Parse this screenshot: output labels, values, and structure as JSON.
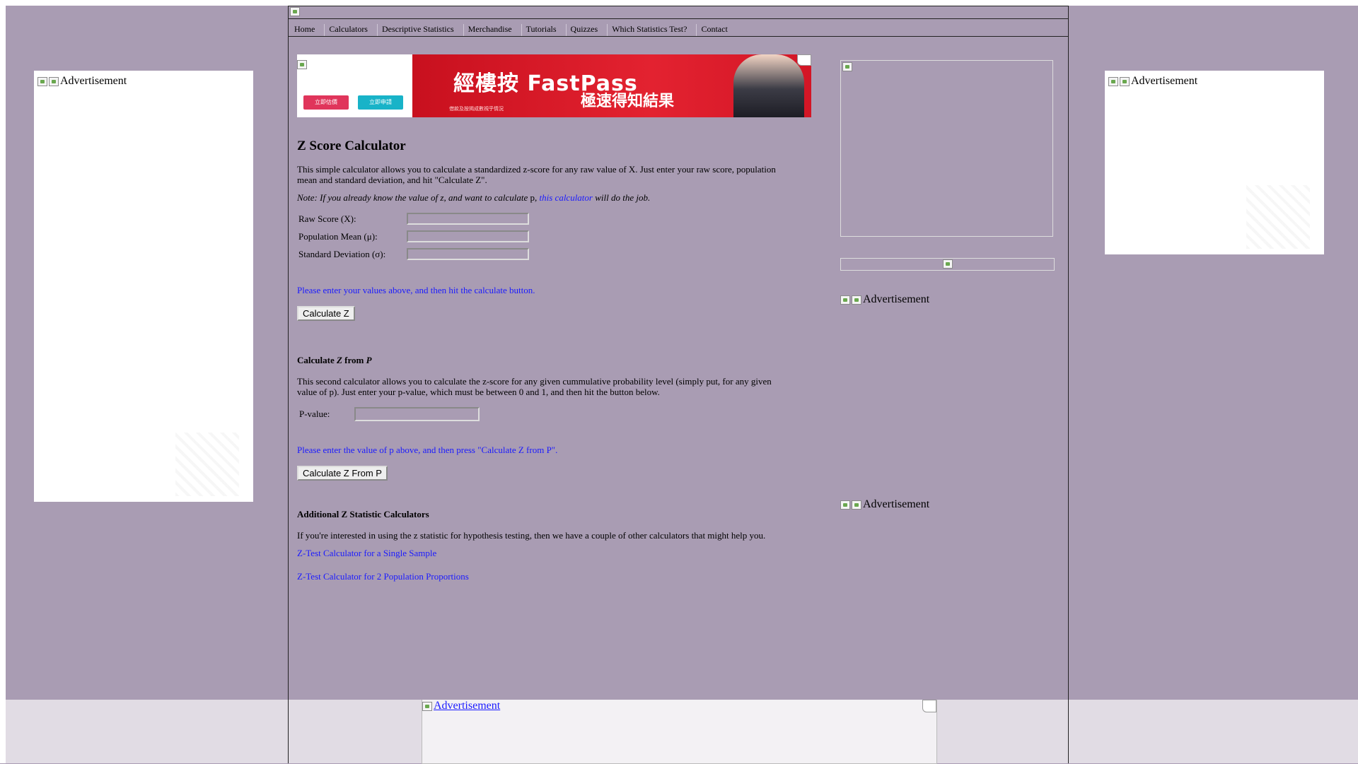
{
  "page": {
    "background": "#a99cb3",
    "link_color": "#1a1aff"
  },
  "nav": {
    "items": [
      "Home",
      "Calculators",
      "Descriptive Statistics",
      "Merchandise",
      "Tutorials",
      "Quizzes",
      "Which Statistics Test?",
      "Contact"
    ]
  },
  "ads": {
    "left_label": "Advertisement",
    "right_label": "Advertisement",
    "sidebar_label_1": "Advertisement",
    "sidebar_label_2": "Advertisement",
    "bottom_label": "Advertisement",
    "top_banner": {
      "title": "經樓按 FastPass",
      "subtitle": "極速得知結果",
      "button_1": "立即估價",
      "button_2": "立即申請",
      "fine_print": "借款及按揭成數視乎情況"
    }
  },
  "main": {
    "title": "Z Score Calculator",
    "intro": "This simple calculator allows you to calculate a standardized z-score for any raw value of X. Just enter your raw score, population mean and standard deviation, and hit \"Calculate Z\".",
    "note_prefix": "Note: If you already know the value of z, and want to calculate",
    "note_p": "p,",
    "note_link": "this calculator",
    "note_suffix": "will do the job.",
    "fields": [
      {
        "label": "Raw Score (X):",
        "value": ""
      },
      {
        "label": "Population Mean (μ):",
        "value": ""
      },
      {
        "label": "Standard Deviation (σ):",
        "value": ""
      }
    ],
    "message": "Please enter your values above, and then hit the calculate button.",
    "button": "Calculate Z"
  },
  "section2": {
    "title_prefix": "Calculate ",
    "title_z": "Z",
    "title_mid": " from ",
    "title_p": "P",
    "text": "This second calculator allows you to calculate the z-score for any given cummulative probability level (simply put, for any given value of p). Just enter your p-value, which must be between 0 and 1, and then hit the button below.",
    "field_label": "P-value:",
    "field_value": "",
    "message": "Please enter the value of p above, and then press \"Calculate Z from P\".",
    "button": "Calculate Z From P"
  },
  "section3": {
    "title": "Additional Z Statistic Calculators",
    "text": "If you're interested in using the z statistic for hypothesis testing, then we have a couple of other calculators that might help you.",
    "links": [
      "Z-Test Calculator for a Single Sample",
      "Z-Test Calculator for 2 Population Proportions"
    ]
  }
}
